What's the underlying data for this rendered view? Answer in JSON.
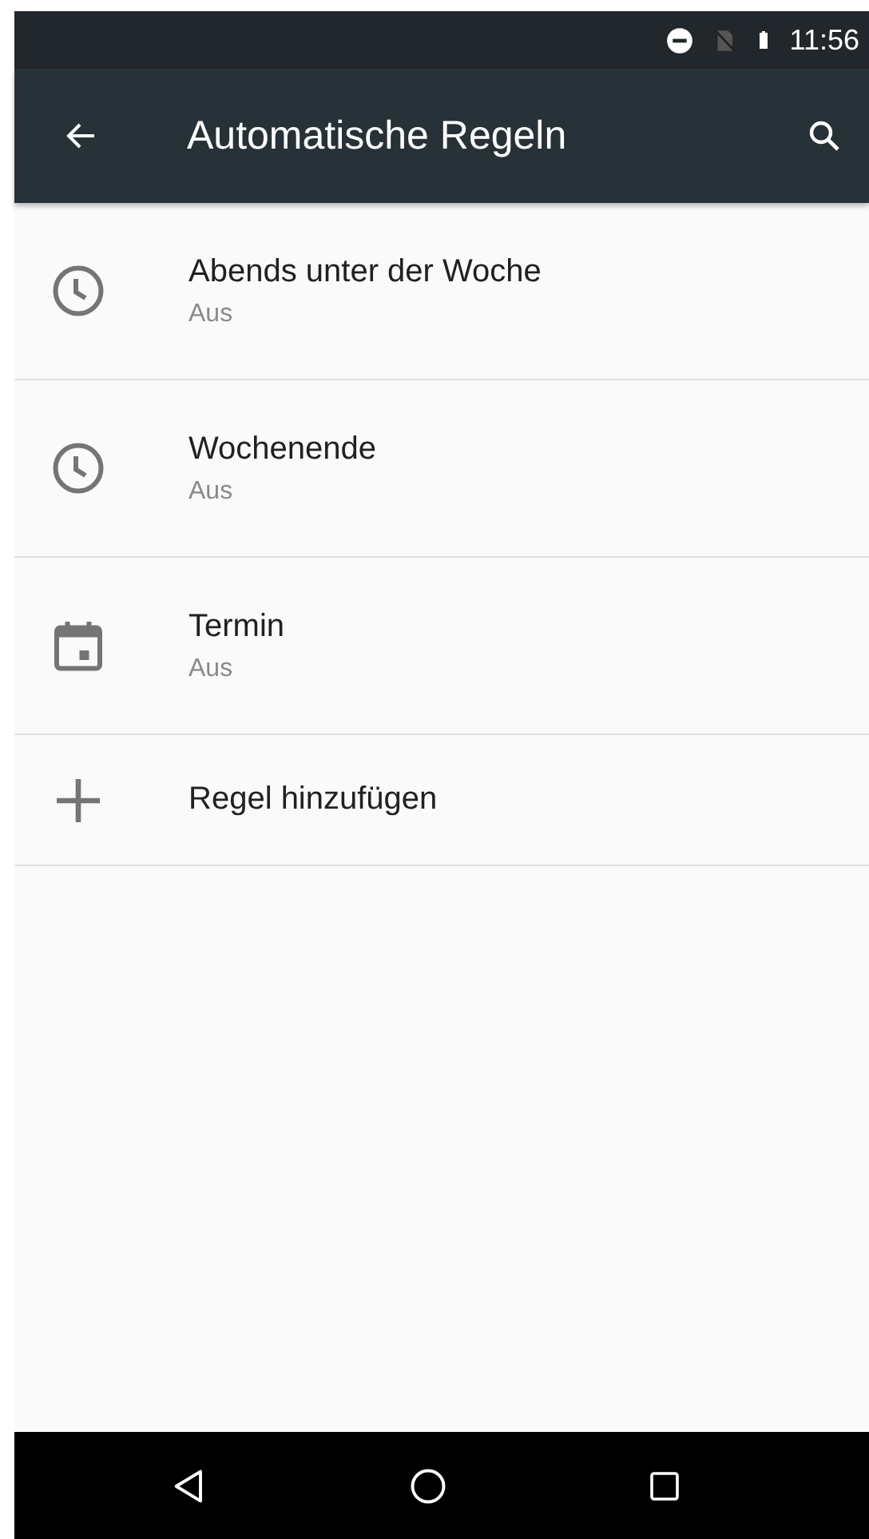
{
  "status_bar": {
    "time": "11:56"
  },
  "app_bar": {
    "title": "Automatische Regeln"
  },
  "rules": [
    {
      "kind": "clock",
      "title": "Abends unter der Woche",
      "subtitle": "Aus"
    },
    {
      "kind": "clock",
      "title": "Wochenende",
      "subtitle": "Aus"
    },
    {
      "kind": "calendar",
      "title": "Termin",
      "subtitle": "Aus"
    },
    {
      "kind": "add",
      "title": "Regel hinzufügen"
    }
  ]
}
